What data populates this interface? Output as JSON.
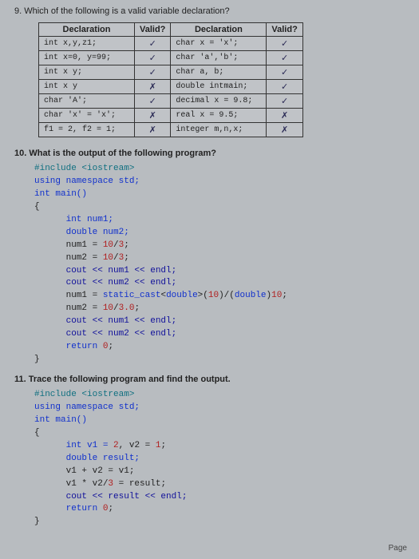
{
  "q9": {
    "title": "9.  Which of the following is a valid variable declaration?",
    "headers": [
      "Declaration",
      "Valid?",
      "Declaration",
      "Valid?"
    ],
    "rows": [
      [
        "int x,y,z1;",
        "✓",
        "char x = 'x';",
        "✓"
      ],
      [
        "int x=0, y=99;",
        "✓",
        "char 'a','b';",
        "✓"
      ],
      [
        "int x y;",
        "✓",
        "char a, b;",
        "✓"
      ],
      [
        "int x y",
        "✗",
        "double intmain;",
        "✓"
      ],
      [
        "char 'A';",
        "✓",
        "decimal x = 9.8;",
        "✓"
      ],
      [
        "char 'x' = 'x';",
        "✗",
        "real x = 9.5;",
        "✗"
      ],
      [
        "f1 = 2, f2 = 1;",
        "✗",
        "integer m,n,x;",
        "✗"
      ]
    ]
  },
  "q10": {
    "title": "10. What is the output of the following program?",
    "c": {
      "include": "#include <iostream>",
      "using": "using namespace std;",
      "intmain": "int main()",
      "ob": "{",
      "l1": "      int num1;",
      "l2": "      double num2;",
      "l3a": "      num1 = ",
      "l3b": "10",
      "l3c": "/",
      "l3d": "3",
      "l3e": ";",
      "l4a": "      num2 = ",
      "l4b": "10",
      "l4c": "/",
      "l4d": "3",
      "l4e": ";",
      "l5": "      cout << num1 << endl;",
      "l6": "      cout << num2 << endl;",
      "l7a": "      num1 = ",
      "l7b": "static_cast",
      "l7c": "<",
      "l7d": "double",
      "l7e": ">(",
      "l7f": "10",
      "l7g": ")/(",
      "l7h": "double",
      "l7i": ")",
      "l7j": "10",
      "l7k": ";",
      "l8a": "      num2 = ",
      "l8b": "10",
      "l8c": "/",
      "l8d": "3.0",
      "l8e": ";",
      "l9": "      cout << num1 << endl;",
      "l10": "      cout << num2 << endl;",
      "l11a": "      return ",
      "l11b": "0",
      "l11c": ";",
      "cb": "}"
    }
  },
  "q11": {
    "title": "11. Trace the following program and find the output.",
    "c": {
      "include": "#include <iostream>",
      "using": "using namespace std;",
      "intmain": "int main()",
      "ob": "{",
      "l1a": "      int v1 = ",
      "l1b": "2",
      "l1c": ", v2 = ",
      "l1d": "1",
      "l1e": ";",
      "l2": "      double result;",
      "l3": "      v1 + v2 = v1;",
      "l4a": "      v1 * v2/",
      "l4b": "3",
      "l4c": " = result;",
      "l5": "      cout << result << endl;",
      "l6a": "      return ",
      "l6b": "0",
      "l6c": ";",
      "cb": "}"
    }
  },
  "page": "Page"
}
